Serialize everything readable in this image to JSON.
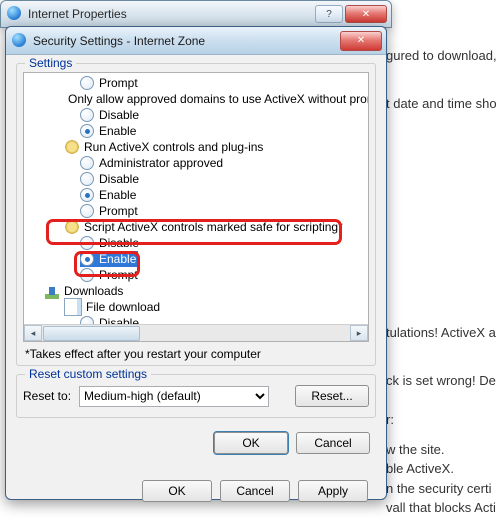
{
  "background": {
    "line1": "gured to download,",
    "line2": "t date and time sho",
    "line3": "tulations! ActiveX a",
    "line4": "ck is set wrong! De",
    "line5": "r:",
    "line6": "w the site.",
    "line7": "ble ActiveX.",
    "line8": "n the security certi",
    "line9": "vall that blocks Acti"
  },
  "parent": {
    "title": "Internet Properties",
    "min": "—",
    "max": "▭",
    "close": "✕",
    "ok": "OK",
    "cancel": "Cancel",
    "apply": "Apply"
  },
  "dialog": {
    "title": "Security Settings - Internet Zone",
    "close": "✕",
    "settings_legend": "Settings",
    "note": "*Takes effect after you restart your computer",
    "reset_legend": "Reset custom settings",
    "reset_to_label": "Reset to:",
    "reset_combo": "Medium-high (default)",
    "reset_btn": "Reset...",
    "ok": "OK",
    "cancel": "Cancel"
  },
  "tree": {
    "r0": "Prompt",
    "g1": "Only allow approved domains to use ActiveX without prompt",
    "r1a": "Disable",
    "r1b": "Enable",
    "g2": "Run ActiveX controls and plug-ins",
    "r2a": "Administrator approved",
    "r2b": "Disable",
    "r2c": "Enable",
    "r2d": "Prompt",
    "g3": "Script ActiveX controls marked safe for scripting*",
    "r3a": "Disable",
    "r3b": "Enable",
    "r3c": "Prompt",
    "g4": "Downloads",
    "g4a": "File download",
    "r4a": "Disable"
  }
}
